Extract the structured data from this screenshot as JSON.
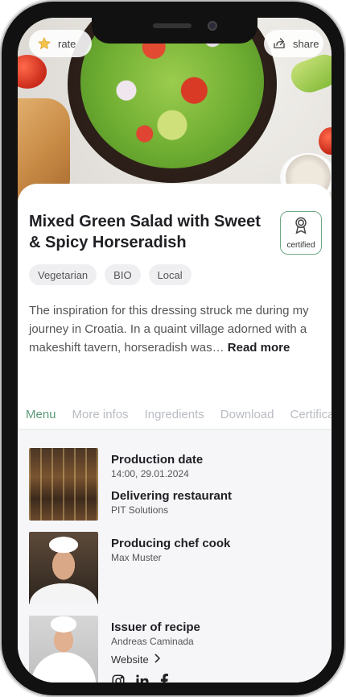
{
  "hero": {
    "rate_label": "rate",
    "share_label": "share",
    "rate_icon": "star-icon",
    "share_icon": "share-icon"
  },
  "recipe": {
    "title": "Mixed Green Salad with Sweet & Spicy Horseradish",
    "certified_label": "certified",
    "tags": [
      "Vegetarian",
      "BIO",
      "Local"
    ],
    "description": "The inspiration for this dressing struck me during my journey in Croatia. In a quaint village adorned with a makeshift tavern, horseradish was…",
    "read_more": "Read more"
  },
  "tabs": [
    {
      "label": "Menu",
      "active": true
    },
    {
      "label": "More infos",
      "active": false
    },
    {
      "label": "Ingredients",
      "active": false
    },
    {
      "label": "Download",
      "active": false
    },
    {
      "label": "Certificates",
      "active": false
    }
  ],
  "details": {
    "production_date_label": "Production date",
    "production_date": "14:00, 29.01.2024",
    "restaurant_label": "Delivering restaurant",
    "restaurant": "PIT Solutions",
    "chef_label": "Producing chef cook",
    "chef": "Max Muster",
    "issuer_label": "Issuer of recipe",
    "issuer": "Andreas Caminada",
    "website_label": "Website",
    "socials": [
      "instagram-icon",
      "linkedin-icon",
      "facebook-icon"
    ]
  },
  "colors": {
    "accent": "#5a9a76",
    "text": "#1f1f24",
    "muted": "#b8bcc2"
  }
}
